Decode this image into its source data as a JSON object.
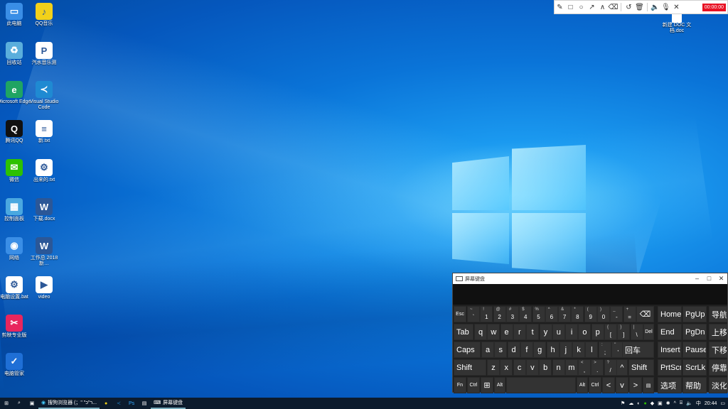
{
  "desktop": {
    "icons": [
      {
        "label": "此电脑",
        "color": "#3a8ee6",
        "glyph": "▭"
      },
      {
        "label": "QQ音乐",
        "color": "#f2d11a",
        "glyph": "♪"
      },
      {
        "label": "回收站",
        "color": "#5aaedc",
        "glyph": "♻"
      },
      {
        "label": "汽水音乐测",
        "color": "#ffffff",
        "glyph": "P"
      },
      {
        "label": "Microsoft Edge",
        "color": "#1fa463",
        "glyph": "e"
      },
      {
        "label": "Visual Studio Code",
        "color": "#1f8ad2",
        "glyph": "≺"
      },
      {
        "label": "腾讯QQ",
        "color": "#111111",
        "glyph": "Q"
      },
      {
        "label": "新.txt",
        "color": "#ffffff",
        "glyph": "≡"
      },
      {
        "label": "微信",
        "color": "#2dc100",
        "glyph": "✉"
      },
      {
        "label": "出来的.txt",
        "color": "#ffffff",
        "glyph": "⚙"
      },
      {
        "label": "控制面板",
        "color": "#4aa8e0",
        "glyph": "▦"
      },
      {
        "label": "下载.docx",
        "color": "#2b5797",
        "glyph": "W"
      },
      {
        "label": "网络",
        "color": "#3a8ee6",
        "glyph": "◉"
      },
      {
        "label": "工作总 2018新…",
        "color": "#2b5797",
        "glyph": "W"
      },
      {
        "label": "电脑设置.bat",
        "color": "#ffffff",
        "glyph": "⚙"
      },
      {
        "label": "video",
        "color": "#ffffff",
        "glyph": "▶"
      },
      {
        "label": "剪映专业版",
        "color": "#e8265e",
        "glyph": "✂"
      },
      {
        "label": "电脑管家",
        "color": "#1f6fd6",
        "glyph": "✓"
      }
    ],
    "right_file": "新建 DOC 文档.doc"
  },
  "recorder": {
    "tools": [
      "pencil-icon",
      "rectangle-icon",
      "circle-icon",
      "arrow-icon",
      "line-icon",
      "eraser-icon",
      "undo-icon",
      "delete-icon",
      "speaker-icon",
      "mic-icon",
      "close-icon"
    ],
    "timer": "00:00:00"
  },
  "osk": {
    "title": "屏幕键盘",
    "row1": {
      "esc": "Esc",
      "keys": [
        {
          "s": "~",
          "m": "`"
        },
        {
          "s": "!",
          "m": "1"
        },
        {
          "s": "@",
          "m": "2"
        },
        {
          "s": "#",
          "m": "3"
        },
        {
          "s": "$",
          "m": "4"
        },
        {
          "s": "%",
          "m": "5"
        },
        {
          "s": "^",
          "m": "6"
        },
        {
          "s": "&",
          "m": "7"
        },
        {
          "s": "*",
          "m": "8"
        },
        {
          "s": "(",
          "m": "9"
        },
        {
          "s": ")",
          "m": "0"
        },
        {
          "s": "_",
          "m": "-"
        },
        {
          "s": "+",
          "m": "="
        }
      ],
      "backspace": "⌫"
    },
    "row2": {
      "tab": "Tab",
      "letters": [
        "q",
        "w",
        "e",
        "r",
        "t",
        "y",
        "u",
        "i",
        "o",
        "p"
      ],
      "brackets": [
        {
          "s": "{",
          "m": "["
        },
        {
          "s": "}",
          "m": "]"
        },
        {
          "s": "|",
          "m": "\\"
        }
      ],
      "del": "Del"
    },
    "row3": {
      "caps": "Caps",
      "letters": [
        "a",
        "s",
        "d",
        "f",
        "g",
        "h",
        "j",
        "k",
        "l"
      ],
      "punct": [
        {
          "s": ":",
          "m": ";"
        },
        {
          "s": "\"",
          "m": "'"
        }
      ],
      "enter": "回车"
    },
    "row4": {
      "shift": "Shift",
      "letters": [
        "z",
        "x",
        "c",
        "v",
        "b",
        "n",
        "m"
      ],
      "punct": [
        {
          "s": "<",
          "m": ","
        },
        {
          "s": ">",
          "m": "."
        },
        {
          "s": "?",
          "m": "/"
        }
      ],
      "up": "^",
      "shift_r": "Shift"
    },
    "row5": {
      "fn": "Fn",
      "ctrl": "Ctrl",
      "win": "⊞",
      "alt": "Alt",
      "alt_r": "Alt",
      "ctrl_r": "Ctrl",
      "left": "<",
      "down": "v",
      "right": ">",
      "menu": "▤"
    },
    "nav": {
      "home": "Home",
      "pgup": "PgUp",
      "nav": "导航",
      "end": "End",
      "pgdn": "PgDn",
      "up": "上移",
      "insert": "Insert",
      "pause": "Pause",
      "down": "下移",
      "prtscn": "PrtScn",
      "scrlk": "ScrLk",
      "dock": "停靠",
      "options": "选项",
      "help": "帮助",
      "fade": "淡化"
    }
  },
  "taskbar": {
    "apps": [
      "搜狗浏览器 (；\" \"ר\"כ..."
    ],
    "osk_label": "屏幕键盘",
    "time": "20:44"
  }
}
